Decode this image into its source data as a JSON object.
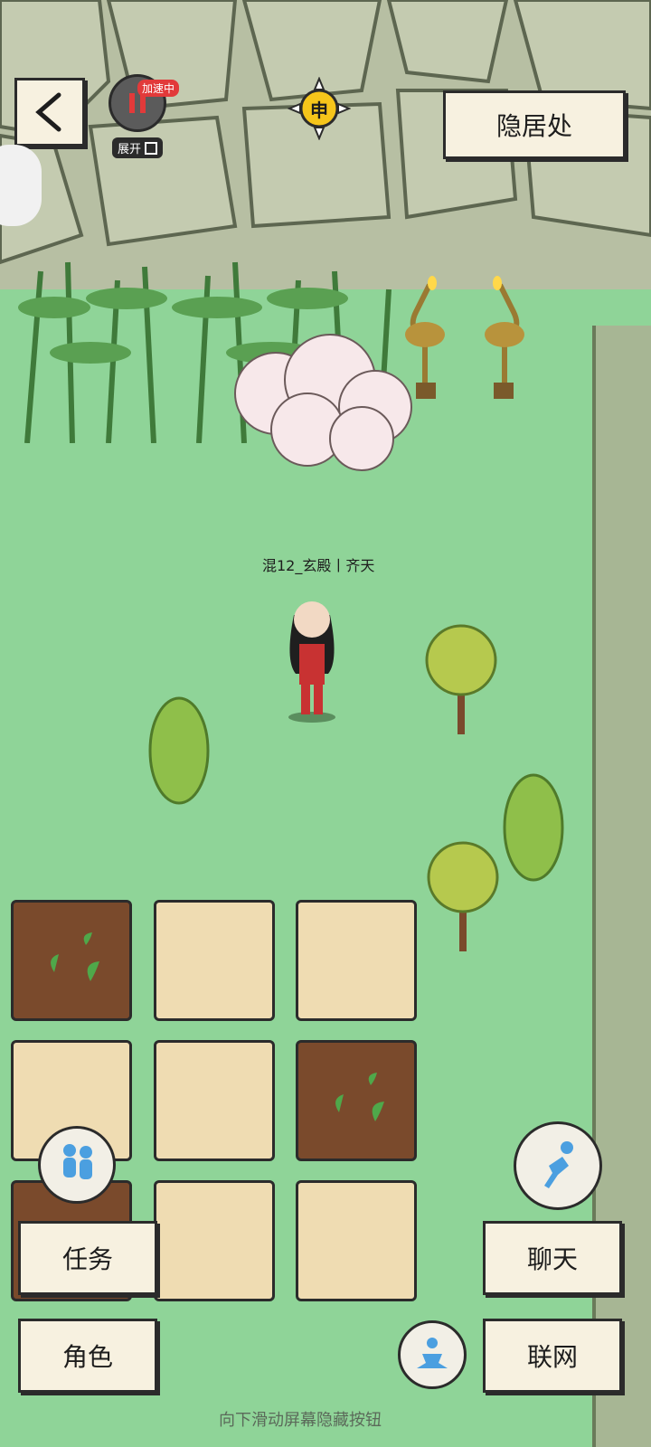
{
  "header": {
    "back_icon": "back-arrow-icon",
    "speed_badge": "加速中",
    "expand_label": "展开",
    "time_glyph": "申",
    "location_label": "隐居处"
  },
  "player": {
    "name_line": "混12_玄殿丨齐天"
  },
  "buttons": {
    "tasks": "任务",
    "character": "角色",
    "chat": "聊天",
    "network": "联网"
  },
  "footer_hint": "向下滑动屏幕隐藏按钮",
  "colors": {
    "grass": "#8fd498",
    "cliff": "#b9c1a6",
    "soil": "#7a4a2c",
    "sand": "#efdcb2",
    "paper": "#f7f1e0"
  },
  "icons": [
    "back-arrow-icon",
    "pause-icon",
    "sun-icon",
    "partners-icon",
    "run-icon",
    "meditate-icon",
    "bamboo-grove-icon",
    "cloud-icon",
    "crane-lamp-icon",
    "tree-icon"
  ]
}
